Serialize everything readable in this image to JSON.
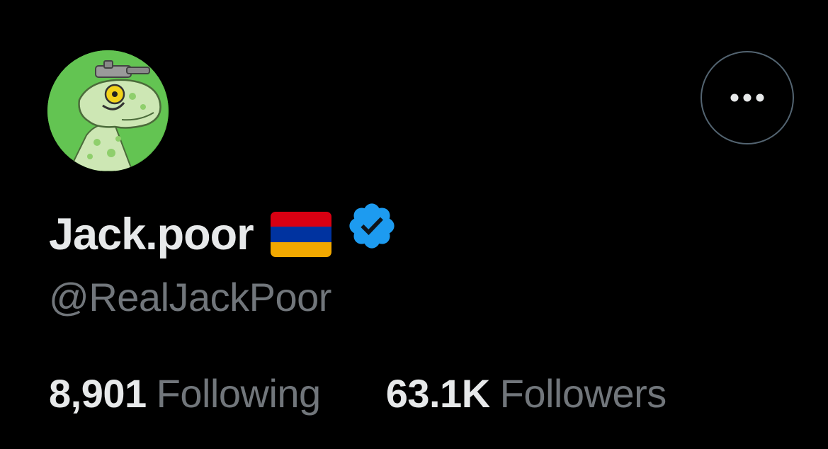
{
  "profile": {
    "display_name": "Jack.poor",
    "handle": "@RealJackPoor",
    "name_flag": "armenia-flag",
    "verified_badge": "verified-check-icon",
    "more_button_icon": "more-horizontal-icon",
    "avatar_icon": "lizard-avatar-image"
  },
  "stats": {
    "following_count": "8,901",
    "following_label": "Following",
    "followers_count": "63.1K",
    "followers_label": "Followers"
  },
  "colors": {
    "background": "#000000",
    "primary_text": "#e7e9ea",
    "secondary_text": "#71767b",
    "verified_blue": "#1d9bf0",
    "flag_red": "#d90012",
    "flag_blue": "#0033a0",
    "flag_orange": "#f2a800"
  }
}
